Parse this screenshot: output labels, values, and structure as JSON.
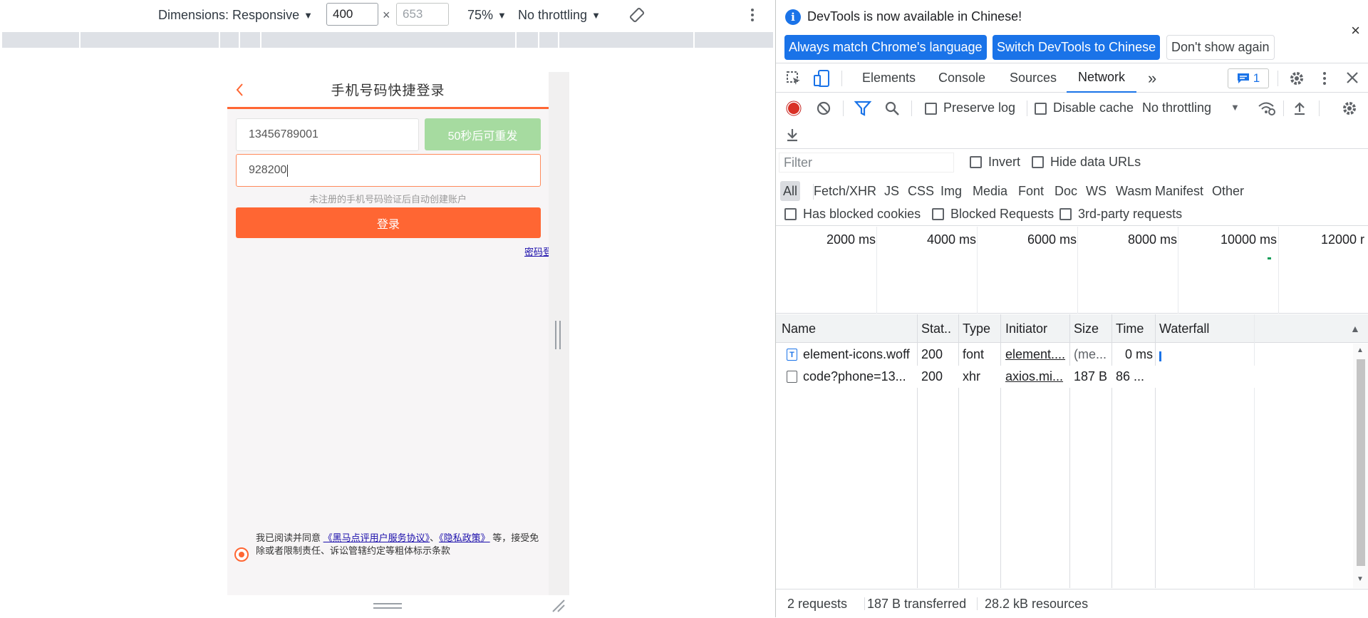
{
  "emulation": {
    "dimensions_label": "Dimensions: Responsive",
    "width": "400",
    "height_placeholder": "653",
    "zoom": "75%",
    "throttling": "No throttling"
  },
  "mobile": {
    "title": "手机号码快捷登录",
    "phone_value": "13456789001",
    "resend_label": "50秒后可重发",
    "code_value": "928200",
    "hint": "未注册的手机号码验证后自动创建账户",
    "login_label": "登录",
    "password_login": "密码登录",
    "agree_prefix": "我已阅读并同意 ",
    "agree_link1": "《黑马点评用户服务协议》",
    "agree_sep": "、",
    "agree_link2": "《隐私政策》",
    "agree_suffix": " 等，接受免除或者限制责任、诉讼管辖约定等粗体标示条款",
    "accent": "#ff6633"
  },
  "devtools": {
    "infobar": {
      "message": "DevTools is now available in Chinese!",
      "btn_match": "Always match Chrome's language",
      "btn_switch": "Switch DevTools to Chinese",
      "btn_dismiss": "Don't show again",
      "close": "×"
    },
    "tabs": [
      "Elements",
      "Console",
      "Sources",
      "Network"
    ],
    "active_tab": "Network",
    "more_tabs": "»",
    "issues_count": "1",
    "toolbar": {
      "preserve_log": "Preserve log",
      "disable_cache": "Disable cache",
      "throttling": "No throttling"
    },
    "filter": {
      "placeholder": "Filter",
      "invert": "Invert",
      "hide_data_urls": "Hide data URLs",
      "types": [
        "All",
        "Fetch/XHR",
        "JS",
        "CSS",
        "Img",
        "Media",
        "Font",
        "Doc",
        "WS",
        "Wasm",
        "Manifest",
        "Other"
      ],
      "has_blocked_cookies": "Has blocked cookies",
      "blocked_requests": "Blocked Requests",
      "third_party": "3rd-party requests"
    },
    "overview_ticks": [
      "2000 ms",
      "4000 ms",
      "6000 ms",
      "8000 ms",
      "10000 ms",
      "12000 r"
    ],
    "columns": [
      "Name",
      "Stat..",
      "Type",
      "Initiator",
      "Size",
      "Time",
      "Waterfall"
    ],
    "rows": [
      {
        "name": "element-icons.woff",
        "status": "200",
        "type": "font",
        "initiator": "element....",
        "size": "(me...",
        "time": "0 ms"
      },
      {
        "name": "code?phone=13...",
        "status": "200",
        "type": "xhr",
        "initiator": "axios.mi...",
        "size": "187 B",
        "time": "86 ..."
      }
    ],
    "status": {
      "requests": "2 requests",
      "transferred": "187 B transferred",
      "resources": "28.2 kB resources"
    }
  }
}
